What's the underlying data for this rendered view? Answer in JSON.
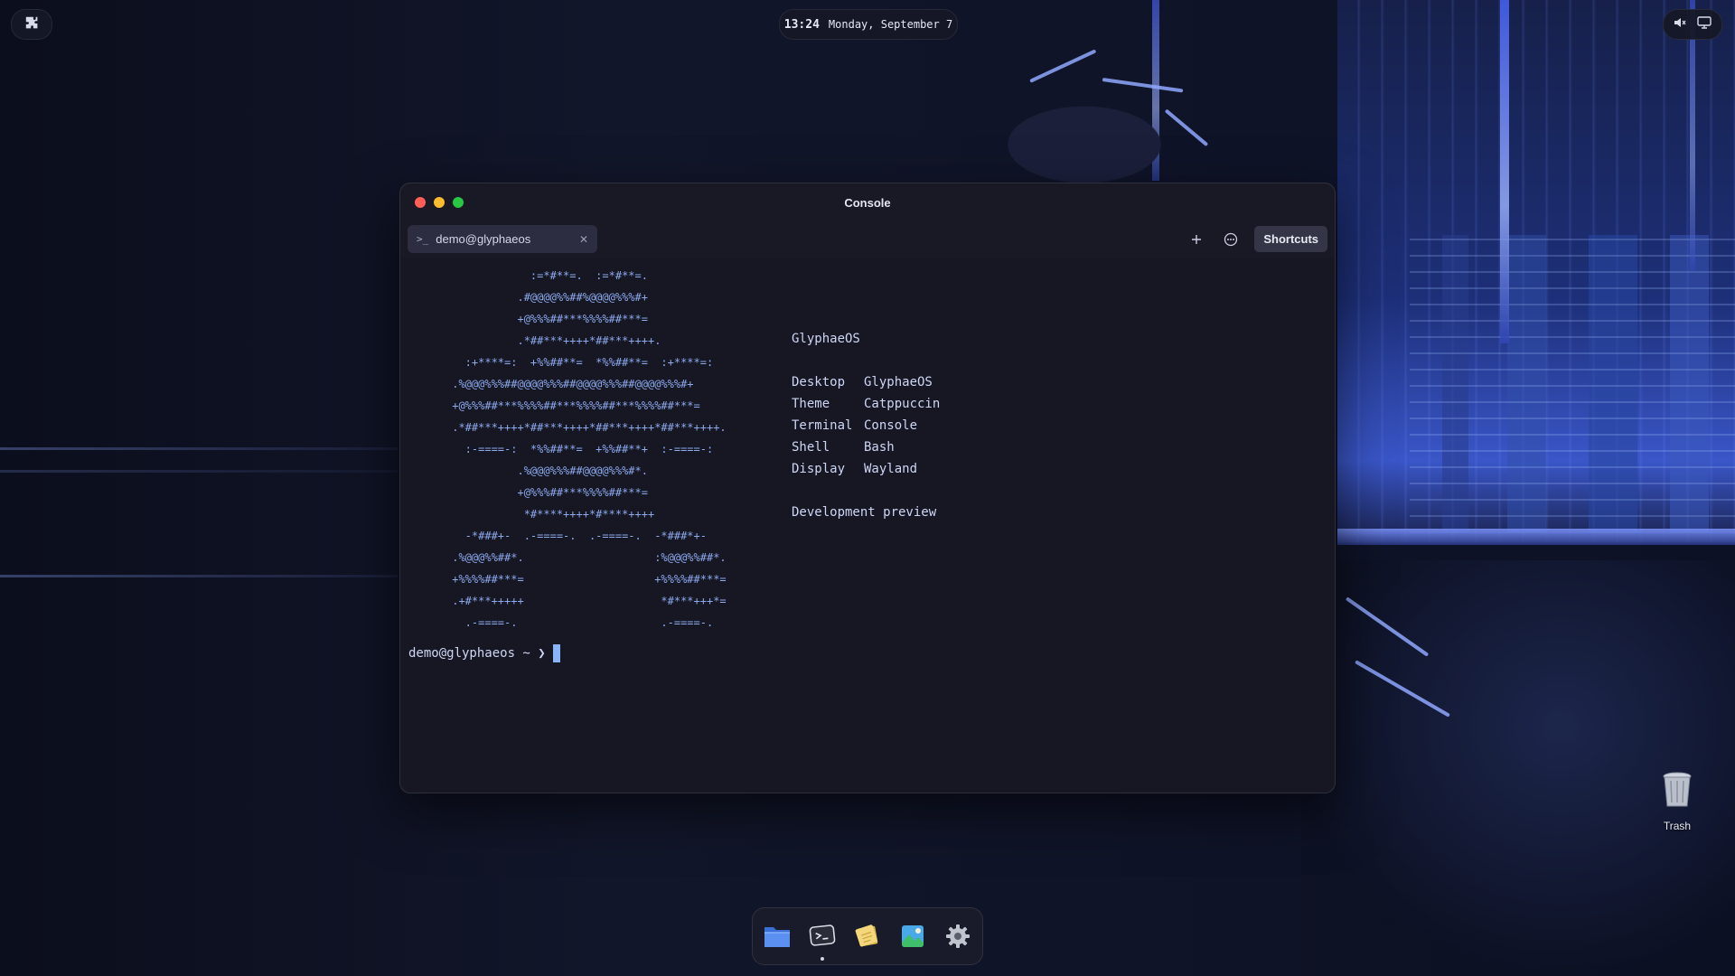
{
  "topbar": {
    "time": "13:24",
    "date": "Monday, September 7"
  },
  "window": {
    "title": "Console",
    "tab_label": "demo@glyphaeos",
    "shortcuts_label": "Shortcuts"
  },
  "terminal": {
    "ascii_art": "             :=*#**=.  :=*#**=.\n           .#@@@@%%##%@@@@%%%#+\n           +@%%%##***%%%%##***=\n           .*##***++++*##***++++.\n   :+****=:  +%%##**=  *%%##**=  :+****=:\n .%@@@%%%##@@@@%%%##@@@@%%%##@@@@%%%#+\n +@%%%##***%%%%##***%%%%##***%%%%##***=\n .*##***++++*##***++++*##***++++*##***++++.\n   :-====-:  *%%##**=  +%%##**+  :-====-:\n           .%@@@%%%##@@@@%%%#*.\n           +@%%%##***%%%%##***=\n            *#****++++*#****++++\n   -*###+-  .-====-.  .-====-.  -*###*+-\n .%@@@%%##*.                    :%@@@%%##*.\n +%%%%##***=                    +%%%%##***=\n .+#***+++++                     *#***+++*=\n   .-====-.                      .-====-.",
    "os_name": "GlyphaeOS",
    "info": [
      {
        "key": "Desktop",
        "value": "GlyphaeOS"
      },
      {
        "key": "Theme",
        "value": "Catppuccin"
      },
      {
        "key": "Terminal",
        "value": "Console"
      },
      {
        "key": "Shell",
        "value": "Bash"
      },
      {
        "key": "Display",
        "value": "Wayland"
      }
    ],
    "footer": "Development preview",
    "prompt": "demo@glyphaeos ~ ❯"
  },
  "desktop": {
    "trash_label": "Trash"
  },
  "dock": {
    "items": [
      "files-icon",
      "console-icon",
      "notes-icon",
      "image-viewer-icon",
      "settings-icon"
    ]
  },
  "colors": {
    "close": "#ff5f57",
    "minimize": "#febc2e",
    "maximize": "#28c840",
    "ascii": "#8caaee",
    "cursor": "#89b4fa"
  }
}
